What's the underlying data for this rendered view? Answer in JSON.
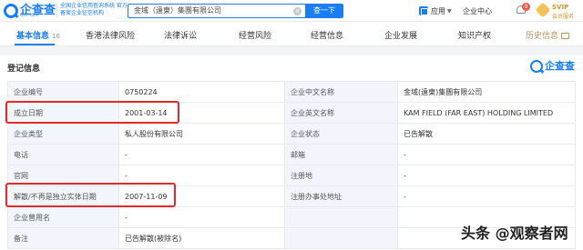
{
  "header": {
    "logo_text": "企查查",
    "logo_domain": "Qcc.com",
    "slogan": "全国企业信用查询系统 官方备案企业征信机构",
    "search_value": "金域（遠東）集團有限公司",
    "search_button": "查一下",
    "app_menu": "应用",
    "enterprise_center": "企业中心",
    "notification_count": "9",
    "svip_title": "SVIP",
    "svip_sub": "会员服务"
  },
  "tabs": [
    {
      "label": "基本信息",
      "count": "16"
    },
    {
      "label": "香港法律风险"
    },
    {
      "label": "法律诉讼"
    },
    {
      "label": "经营风险"
    },
    {
      "label": "经营信息"
    },
    {
      "label": "企业发展"
    },
    {
      "label": "知识产权"
    },
    {
      "label": "历史信息"
    }
  ],
  "section": {
    "title": "登记信息",
    "brand": "企查查"
  },
  "registration": [
    {
      "label": "企业编号",
      "value": "0750224",
      "label2": "企业中文名称",
      "value2": "金域(遠東)集團有限公司"
    },
    {
      "label": "成立日期",
      "value": "2001-03-14",
      "label2": "企业英文名称",
      "value2": "KAM FIELD (FAR EAST) HOLDING LIMITED"
    },
    {
      "label": "企业类型",
      "value": "私人股份有限公司",
      "label2": "企业状态",
      "value2": "已告解散"
    },
    {
      "label": "电话",
      "value": "-",
      "label2": "邮箱",
      "value2": "-"
    },
    {
      "label": "官网",
      "value": "-",
      "label2": "注册地",
      "value2": "-"
    },
    {
      "label": "解散/不再是独立实体日期",
      "value": "2007-11-09",
      "label2": "注册办事处地址",
      "value2": "-"
    },
    {
      "label": "企业曾用名",
      "value": "-",
      "label2": "",
      "value2": ""
    },
    {
      "label": "备注",
      "value": "已告解散(被除名)",
      "label2": "",
      "value2": ""
    }
  ],
  "watermark": "头条 @观察者网",
  "colors": {
    "accent": "#1a7ef2",
    "highlight": "#e12b2b",
    "label_bg": "#f2f6fc"
  }
}
